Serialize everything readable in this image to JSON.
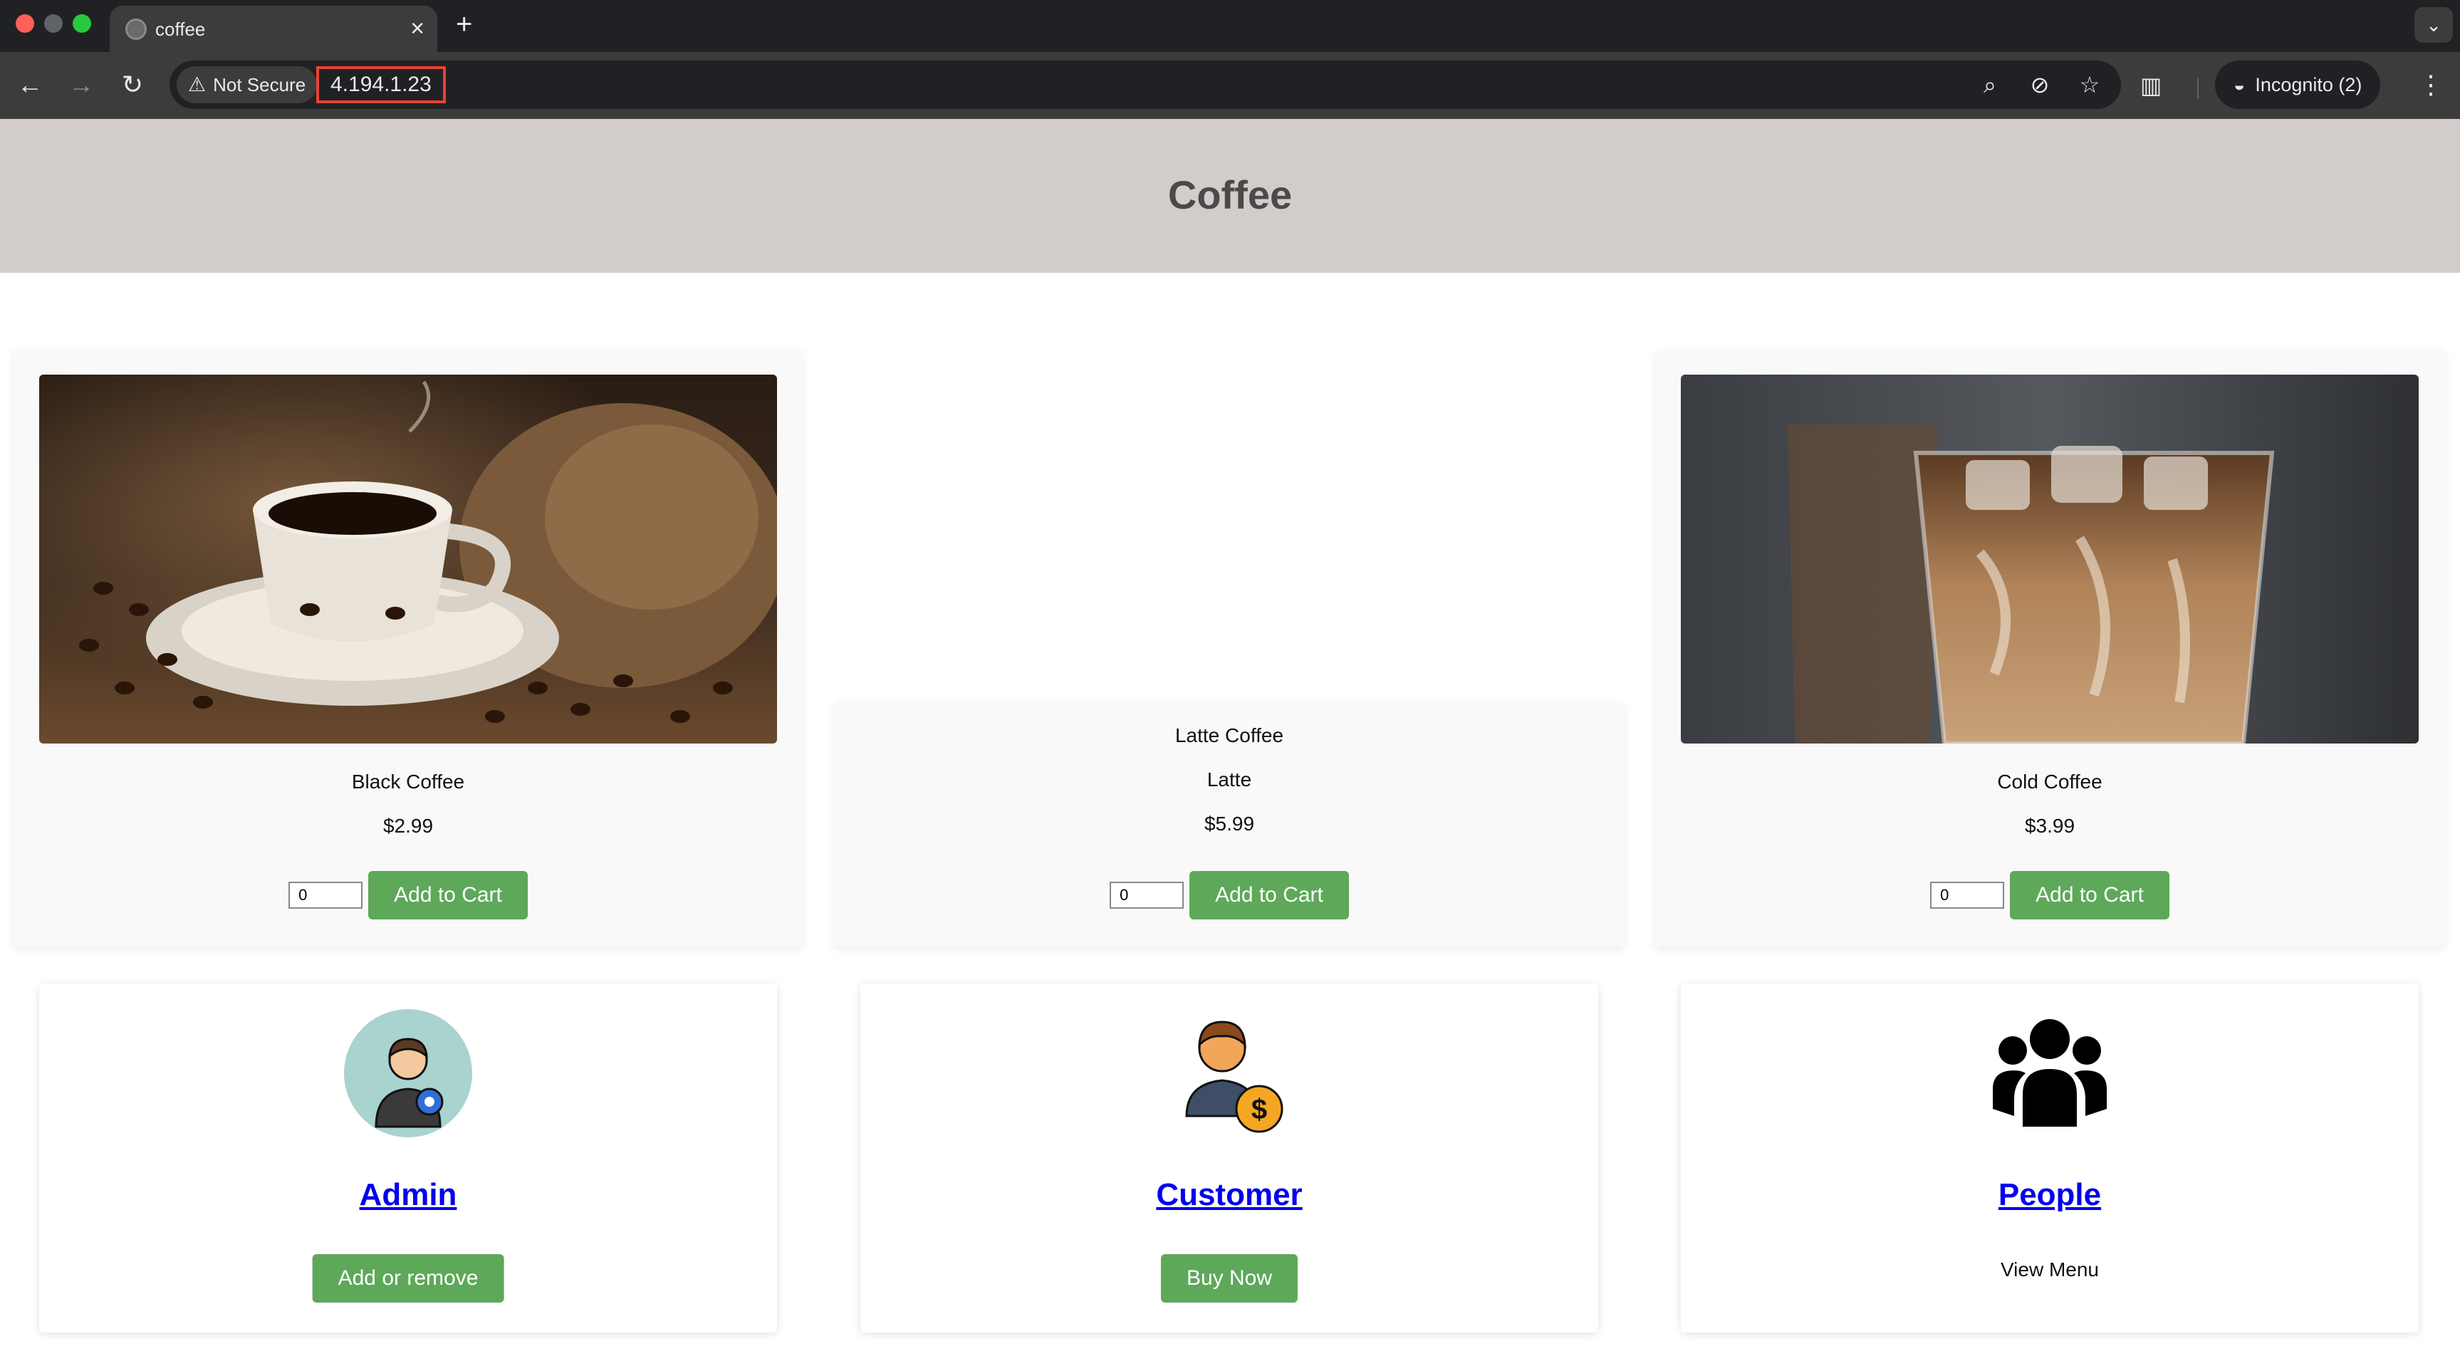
{
  "browser": {
    "tab_title": "coffee",
    "security_label": "Not Secure",
    "url": "4.194.1.23",
    "incognito_label": "Incognito (2)"
  },
  "header": {
    "title": "Coffee"
  },
  "products": [
    {
      "name": "Black Coffee",
      "price": "$2.99",
      "quantity": "0",
      "button": "Add to Cart"
    },
    {
      "alt_text": "Latte Coffee",
      "name": "Latte",
      "price": "$5.99",
      "quantity": "0",
      "button": "Add to Cart"
    },
    {
      "name": "Cold Coffee",
      "price": "$3.99",
      "quantity": "0",
      "button": "Add to Cart"
    }
  ],
  "roles": [
    {
      "title": "Admin",
      "action": "Add or remove"
    },
    {
      "title": "Customer",
      "action": "Buy Now"
    },
    {
      "title": "People",
      "note": "View Menu"
    }
  ],
  "colors": {
    "header_bg": "#d2cdca",
    "button_green": "#5ea85a",
    "link_blue": "#0000ee",
    "url_highlight": "#e94235"
  }
}
